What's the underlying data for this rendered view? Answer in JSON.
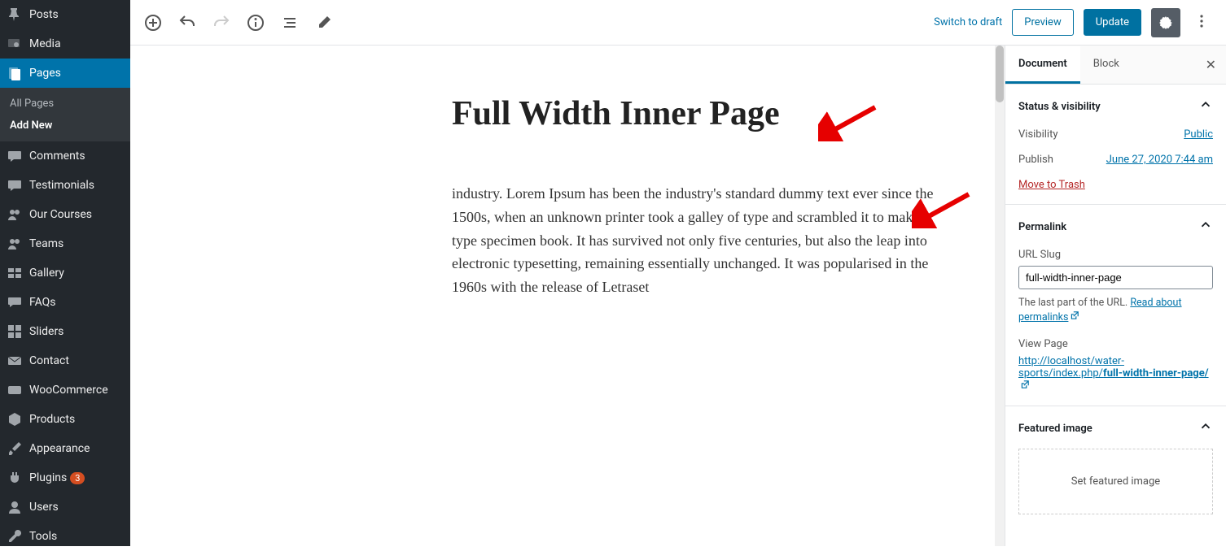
{
  "sidebar": {
    "items": [
      {
        "label": "Posts",
        "icon": "pin"
      },
      {
        "label": "Media",
        "icon": "media"
      },
      {
        "label": "Pages",
        "icon": "page",
        "active": true
      },
      {
        "label": "Comments",
        "icon": "comment"
      },
      {
        "label": "Testimonials",
        "icon": "comment"
      },
      {
        "label": "Our Courses",
        "icon": "users"
      },
      {
        "label": "Teams",
        "icon": "users"
      },
      {
        "label": "Gallery",
        "icon": "gallery"
      },
      {
        "label": "FAQs",
        "icon": "faq"
      },
      {
        "label": "Sliders",
        "icon": "slider"
      },
      {
        "label": "Contact",
        "icon": "mail"
      },
      {
        "label": "WooCommerce",
        "icon": "woo"
      },
      {
        "label": "Products",
        "icon": "product"
      },
      {
        "label": "Appearance",
        "icon": "brush"
      },
      {
        "label": "Plugins",
        "icon": "plug",
        "badge": "3"
      },
      {
        "label": "Users",
        "icon": "user"
      },
      {
        "label": "Tools",
        "icon": "wrench"
      }
    ],
    "submenu": {
      "all": "All Pages",
      "add": "Add New"
    }
  },
  "topbar": {
    "switch_draft": "Switch to draft",
    "preview": "Preview",
    "update": "Update"
  },
  "editor": {
    "title": "Full Width Inner Page",
    "body": "industry. Lorem Ipsum has been the industry's standard dummy text ever since the 1500s, when an unknown printer took a galley of type and scrambled it to make a type specimen book. It has survived not only five centuries, but also the leap into electronic typesetting, remaining essentially unchanged. It was popularised in the 1960s with the release of Letraset"
  },
  "inspector": {
    "tabs": {
      "document": "Document",
      "block": "Block"
    },
    "status": {
      "header": "Status & visibility",
      "visibility_label": "Visibility",
      "visibility_value": "Public",
      "publish_label": "Publish",
      "publish_value": "June 27, 2020 7:44 am",
      "trash": "Move to Trash"
    },
    "permalink": {
      "header": "Permalink",
      "slug_label": "URL Slug",
      "slug_value": "full-width-inner-page",
      "hint_pre": "The last part of the URL. ",
      "hint_link": "Read about permalinks",
      "view_label": "View Page",
      "url_pre": "http://localhost/water-sports/index.php/",
      "url_bold": "full-width-inner-page/"
    },
    "featured": {
      "header": "Featured image",
      "placeholder": "Set featured image"
    }
  }
}
